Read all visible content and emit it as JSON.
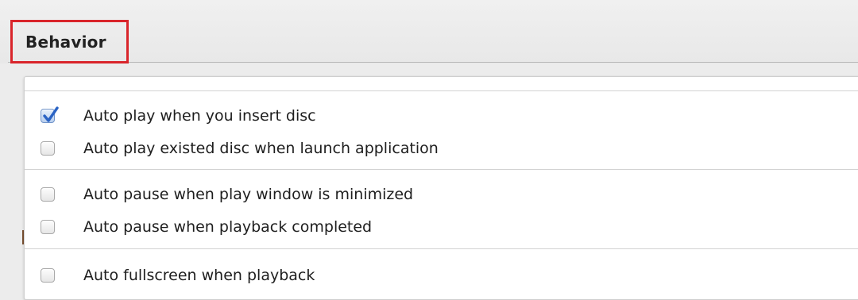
{
  "tabs": {
    "behavior_label": "Behavior"
  },
  "options": [
    {
      "label": "Auto play when you insert disc",
      "checked": true
    },
    {
      "label": "Auto play existed disc when launch application",
      "checked": false
    },
    {
      "label": "Auto pause when play window is minimized",
      "checked": false
    },
    {
      "label": "Auto pause when playback completed",
      "checked": false
    },
    {
      "label": "Auto fullscreen when playback",
      "checked": false
    }
  ],
  "colors": {
    "highlight_border": "#d9252b",
    "checkbox_checked": "#2f6fd1",
    "panel_background": "#ffffff",
    "window_background": "#ececec"
  },
  "icons": {
    "checkmark": "checkmark-icon"
  }
}
